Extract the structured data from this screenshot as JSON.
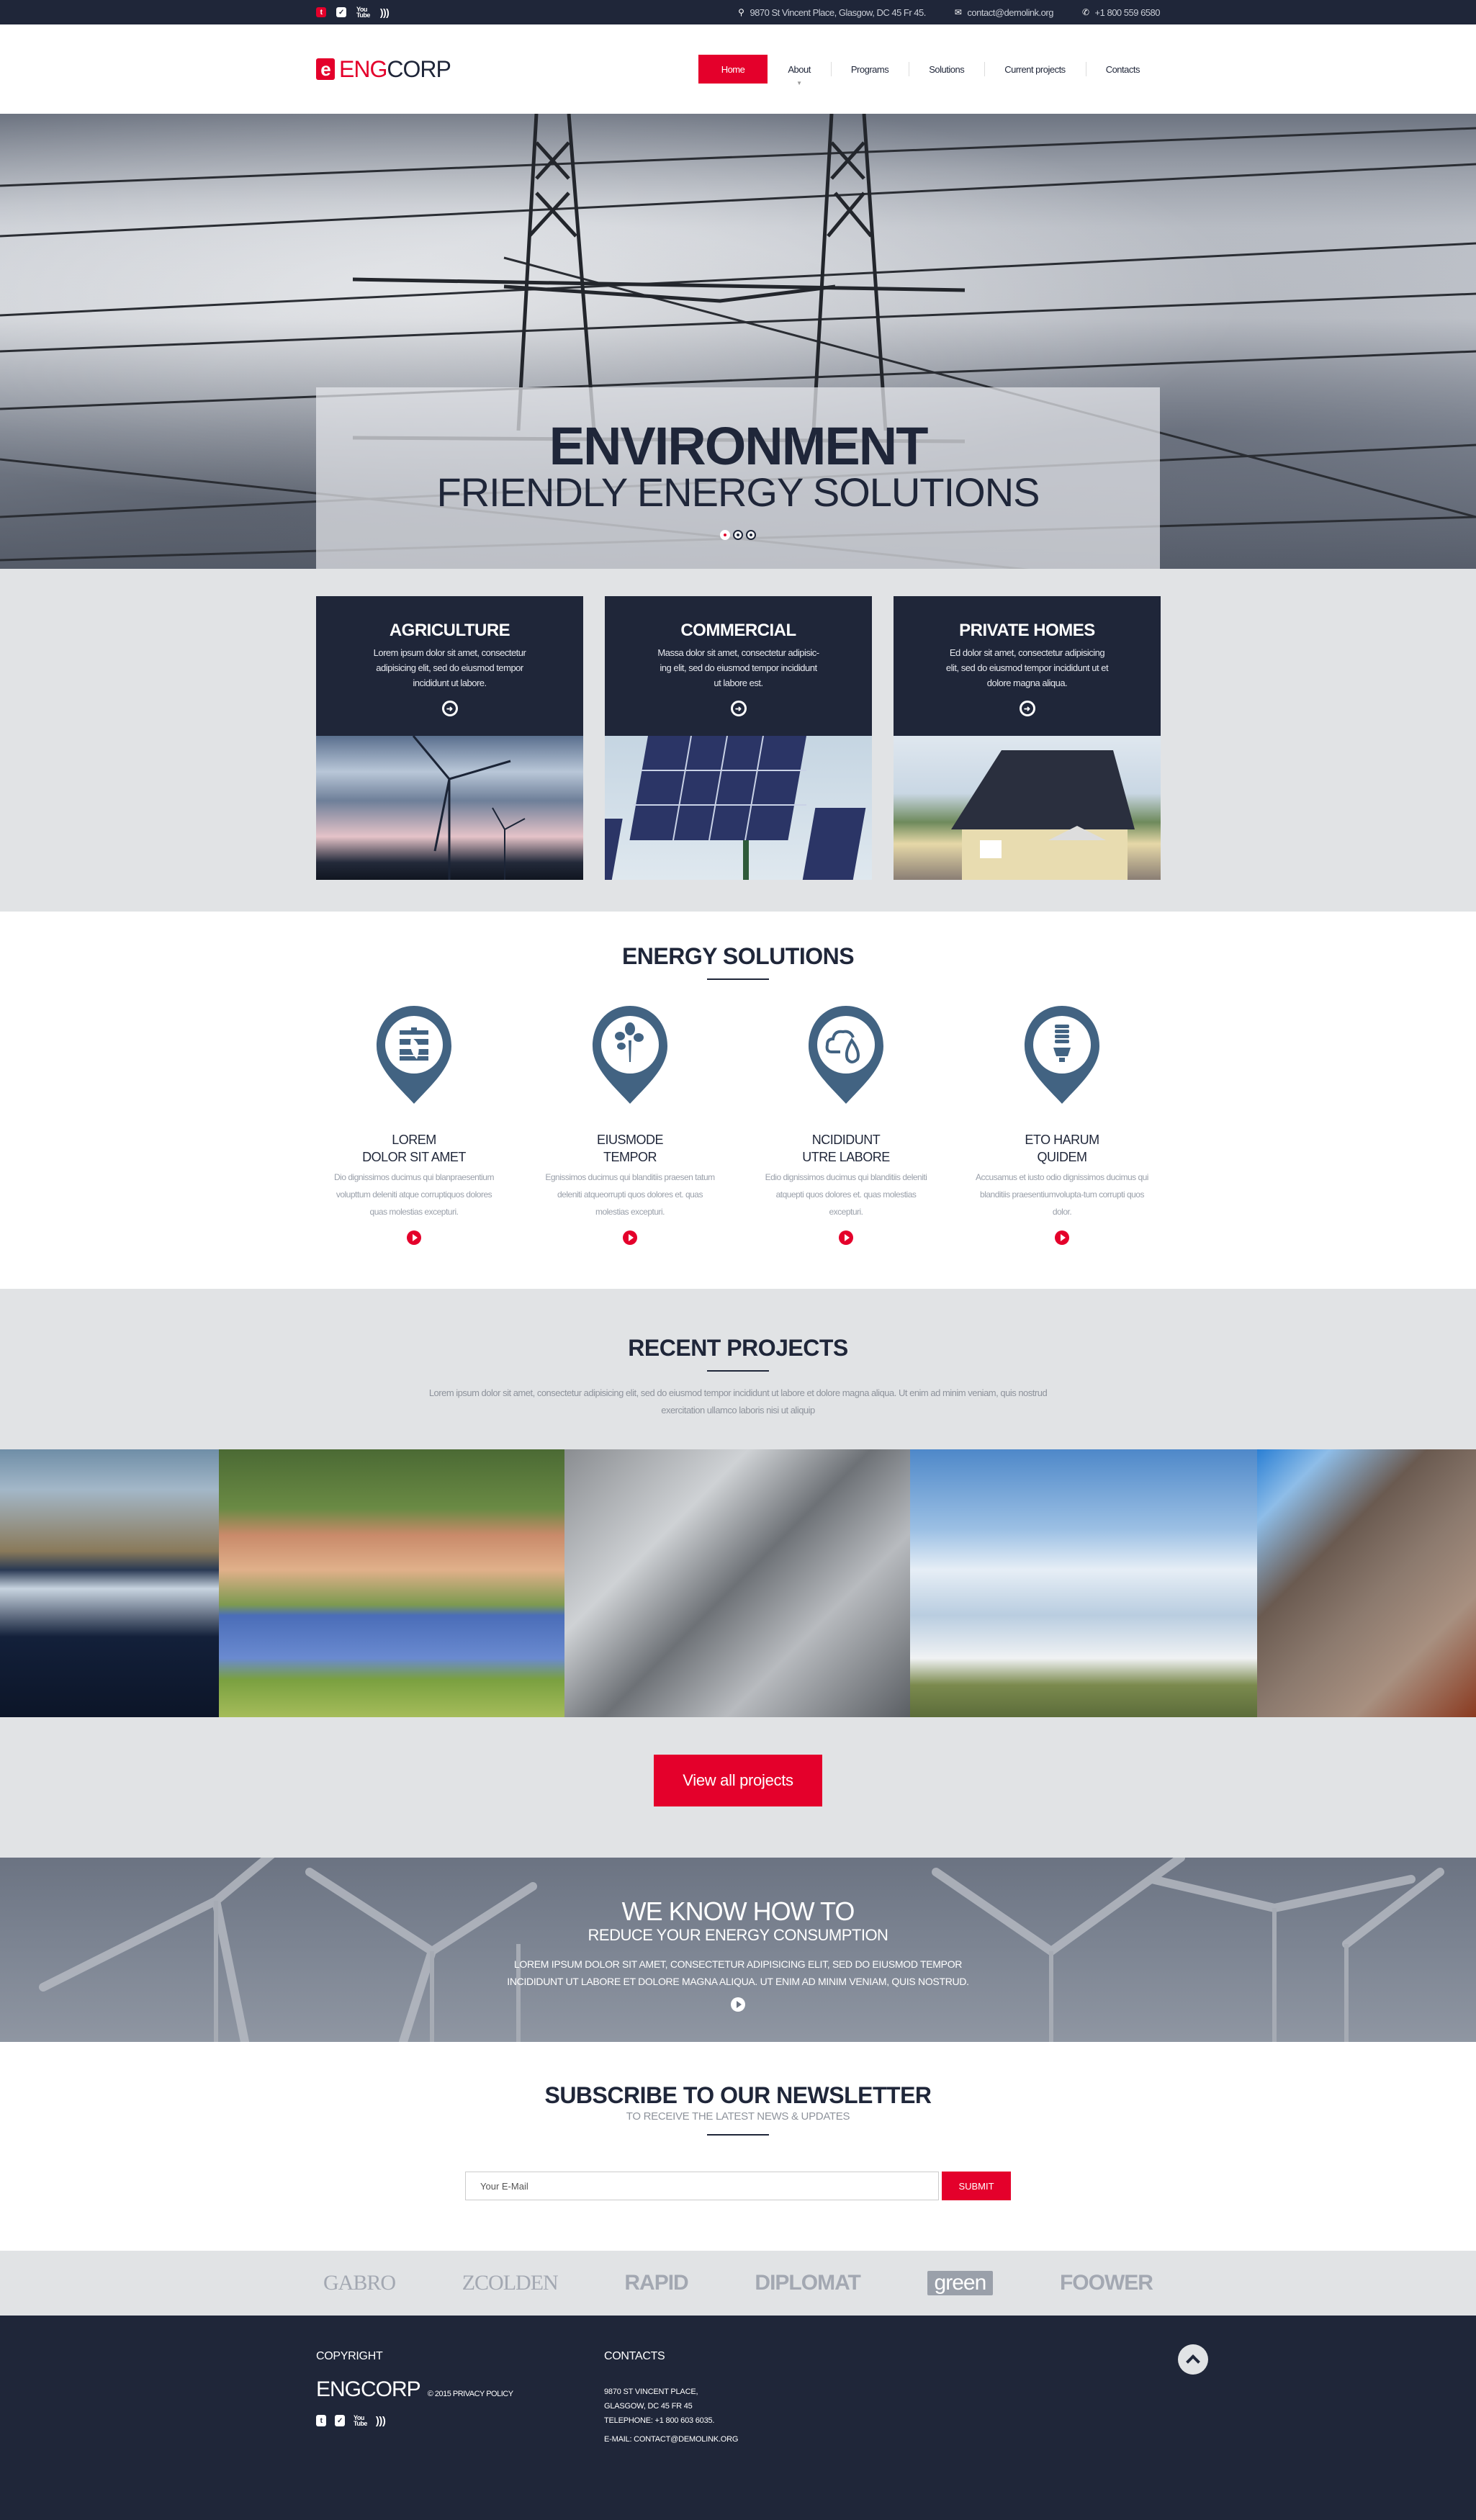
{
  "topbar": {
    "social": [
      {
        "icon": "tumblr-icon",
        "glyph": "t"
      },
      {
        "icon": "twitter-icon",
        "glyph": "🐦"
      },
      {
        "icon": "youtube-icon",
        "glyph": "You Tube"
      },
      {
        "icon": "rss-icon",
        "glyph": "))"
      }
    ],
    "address": "9870 St Vincent Place, Glasgow, DC 45 Fr 45.",
    "email": "contact@demolink.org",
    "phone": "+1 800 559 6580"
  },
  "header": {
    "logo_mark": "e",
    "logo_part1": "ENG",
    "logo_part2": "CORP",
    "nav": [
      "Home",
      "About",
      "Programs",
      "Solutions",
      "Current projects",
      "Contacts"
    ],
    "active_nav": "Home"
  },
  "hero": {
    "title": "ENVIRONMENT",
    "subtitle": "FRIENDLY ENERGY SOLUTIONS",
    "slides": 3,
    "active_slide": 1
  },
  "cards": [
    {
      "title": "AGRICULTURE",
      "text": "Lorem ipsum dolor sit amet, consectetur adipisicing elit, sed do eiusmod tempor incididunt ut labore.",
      "image": "wind turbines at sunset"
    },
    {
      "title": "COMMERCIAL",
      "text": "Massa dolor sit amet, consectetur adipisic-ing elit, sed do eiusmod tempor incididunt ut labore est.",
      "image": "solar panel array"
    },
    {
      "title": "PRIVATE HOMES",
      "text": "Ed dolor sit amet, consectetur adipisicing elit, sed do eiusmod tempor incididunt ut et dolore magna aliqua.",
      "image": "house with rooftop solar panels"
    }
  ],
  "energy": {
    "title": "ENERGY SOLUTIONS",
    "features": [
      {
        "icon": "oil-barrel-leaf-icon",
        "title1": "LOREM",
        "title2": "DOLOR SIT AMET",
        "text": "Dio dignissimos ducimus qui blanpraesentium volupttum deleniti atque corruptiquos dolores quas molestias excepturi."
      },
      {
        "icon": "plant-sprout-icon",
        "title1": "EIUSMODE",
        "title2": "TEMPOR",
        "text": "Egnissimos ducimus qui blanditiis praesen tatum deleniti atqueorrupti quos dolores et. quas molestias excepturi."
      },
      {
        "icon": "cloud-water-drop-icon",
        "title1": "NCIDIDUNT",
        "title2": "UTRE LABORE",
        "text": "Edio dignissimos ducimus qui blanditiis deleniti atquepti quos dolores et. quas molestias excepturi."
      },
      {
        "icon": "energy-saving-bulb-icon",
        "title1": "ETO HARUM",
        "title2": "QUIDEM",
        "text": "Accusamus et iusto odio dignissimos ducimus qui blanditiis praesentiumvolupta-tum corrupti quos dolor."
      }
    ]
  },
  "recent": {
    "title": "RECENT PROJECTS",
    "description": "Lorem ipsum dolor sit amet, consectetur adipisicing elit, sed do eiusmod tempor incididunt ut labore et dolore magna aliqua. Ut enim ad minim veniam, quis nostrud exercitation ullamco laboris nisi ut aliquip",
    "projects": [
      "waterfall",
      "solar farm near houses",
      "electrical substation",
      "wind turbine with storage tanks",
      "worker installing roof panels"
    ],
    "button": "View all projects"
  },
  "know": {
    "title": "WE KNOW HOW TO",
    "subtitle": "REDUCE YOUR ENERGY CONSUMPTION",
    "text": "LOREM IPSUM DOLOR SIT AMET, CONSECTETUR ADIPISICING ELIT, SED DO EIUSMOD TEMPOR INCIDIDUNT UT LABORE ET DOLORE MAGNA ALIQUA. UT ENIM AD MINIM VENIAM, QUIS NOSTRUD."
  },
  "newsletter": {
    "title": "SUBSCRIBE TO OUR NEWSLETTER",
    "subtitle": "TO RECEIVE THE LATEST NEWS & UPDATES",
    "placeholder": "Your E-Mail",
    "button": "SUBMIT"
  },
  "partners": [
    "GABRO",
    "ZCOLDEN",
    "RAPID",
    "DIPLOMAT",
    "green",
    "FOOWER"
  ],
  "footer": {
    "copyright_heading": "COPYRIGHT",
    "brand": "ENGCORP",
    "copy": "© 2015  PRIVACY POLICY",
    "contacts_heading": "CONTACTS",
    "addr1": "9870 ST VINCENT PLACE,",
    "addr2": "GLASGOW, DC 45 FR 45",
    "phone": "TELEPHONE:  +1 800 603 6035.",
    "email": "E-MAIL: CONTACT@DEMOLINK.ORG"
  },
  "colors": {
    "accent": "#e4002b",
    "navy": "#1f2639",
    "icon_blue": "#426382",
    "light_gray": "#e1e3e5"
  }
}
